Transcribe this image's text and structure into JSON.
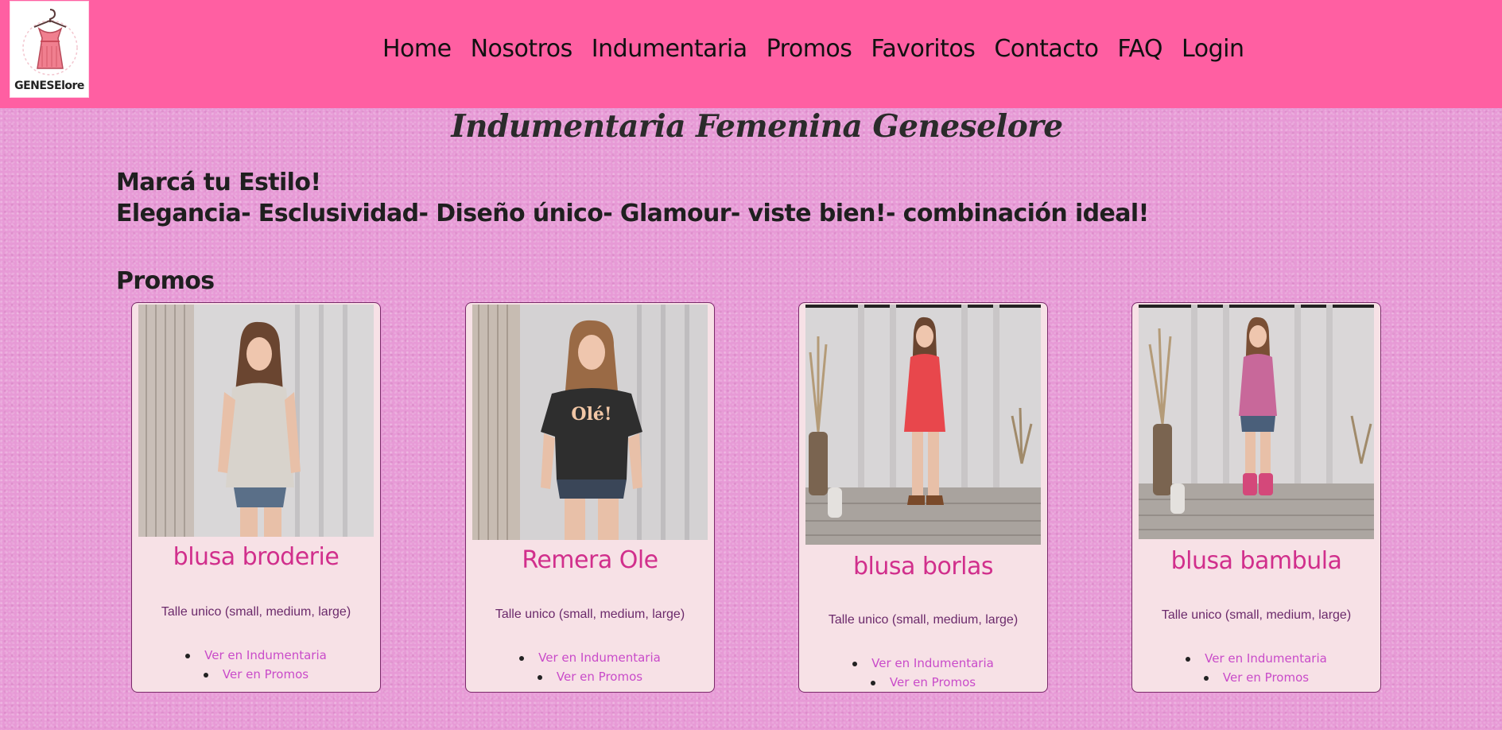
{
  "navbar": {
    "logo_text": "GENESElore",
    "links": [
      "Home",
      "Nosotros",
      "Indumentaria",
      "Promos",
      "Favoritos",
      "Contacto",
      "FAQ",
      "Login"
    ]
  },
  "site_title": "Indumentaria Femenina Geneselore",
  "slogan": {
    "line1": "Marcá tu Estilo!",
    "line2": "Elegancia- Esclusividad- Diseño único- Glamour- viste bien!- combinación ideal!"
  },
  "promos_heading": "Promos",
  "cards": [
    {
      "title": "blusa broderie",
      "size": "Talle unico (small, medium, large)",
      "link_indumentaria": "Ver en Indumentaria",
      "link_promos": "Ver en Promos",
      "garment_color": "#d8d3cc"
    },
    {
      "title": "Remera Ole",
      "size": "Talle unico (small, medium, large)",
      "link_indumentaria": "Ver en Indumentaria",
      "link_promos": "Ver en Promos",
      "garment_color": "#2e2e2e",
      "shirt_text": "Olé!"
    },
    {
      "title": "blusa borlas",
      "size": "Talle unico (small, medium, large)",
      "link_indumentaria": "Ver en Indumentaria",
      "link_promos": "Ver en Promos",
      "garment_color": "#e8474c"
    },
    {
      "title": "blusa bambula",
      "size": "Talle unico (small, medium, large)",
      "link_indumentaria": "Ver en Indumentaria",
      "link_promos": "Ver en Promos",
      "garment_color": "#c8689a"
    }
  ]
}
